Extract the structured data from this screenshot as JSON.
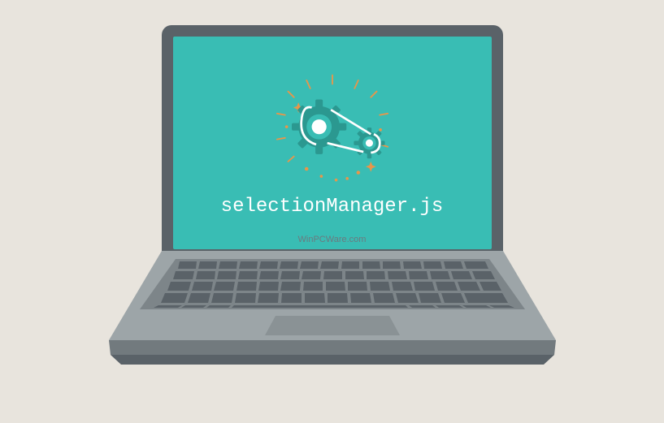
{
  "screen": {
    "filename": "selectionManager.js",
    "watermark": "WinPCWare.com"
  },
  "colors": {
    "background": "#e8e4dd",
    "laptop_frame": "#5a6268",
    "screen": "#39bdb4",
    "accent_orange": "#e8964a",
    "accent_teal": "#2b9890",
    "text": "#ffffff"
  }
}
